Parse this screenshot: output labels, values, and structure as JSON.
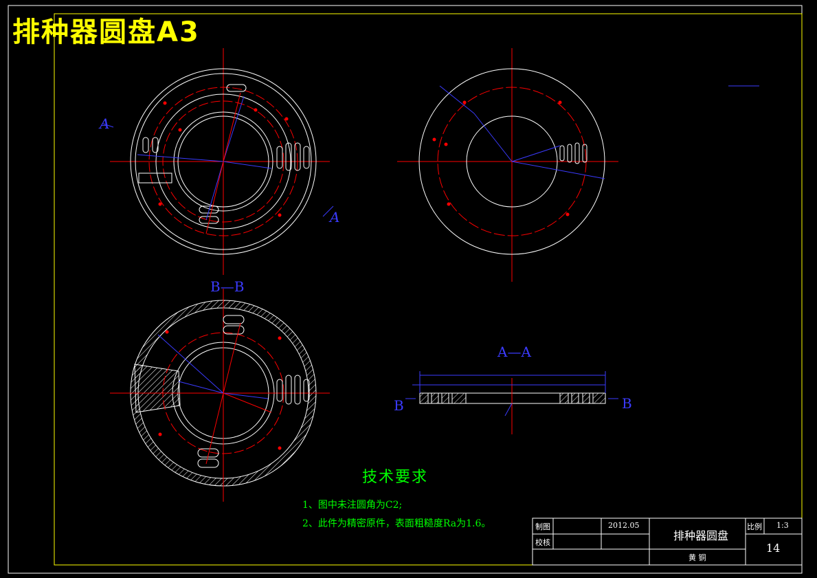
{
  "title": "排种器圆盘A3",
  "views": {
    "view_a_marker_left": "A",
    "view_a_marker_right": "A",
    "section_bb": "B—B",
    "section_aa": "A—A",
    "section_b_left": "B",
    "section_b_right": "B"
  },
  "tech_notes": {
    "heading": "技术要求",
    "items": [
      "1、图中未注圆角为C2;",
      "2、此件为精密原件，表面粗糙度Ra为1.6。"
    ]
  },
  "title_block": {
    "drawn_label": "制图",
    "checked_label": "校核",
    "date": "2012.05",
    "part_name": "排种器圆盘",
    "material": "黄 铜",
    "scale_label": "比例",
    "scale_value": "1:3",
    "sheet_no": "14"
  },
  "colors": {
    "outline": "#ffffff",
    "centerline": "#ff0000",
    "dimension": "#3b3bff",
    "frame": "#ffff00",
    "notes": "#00ff00"
  }
}
